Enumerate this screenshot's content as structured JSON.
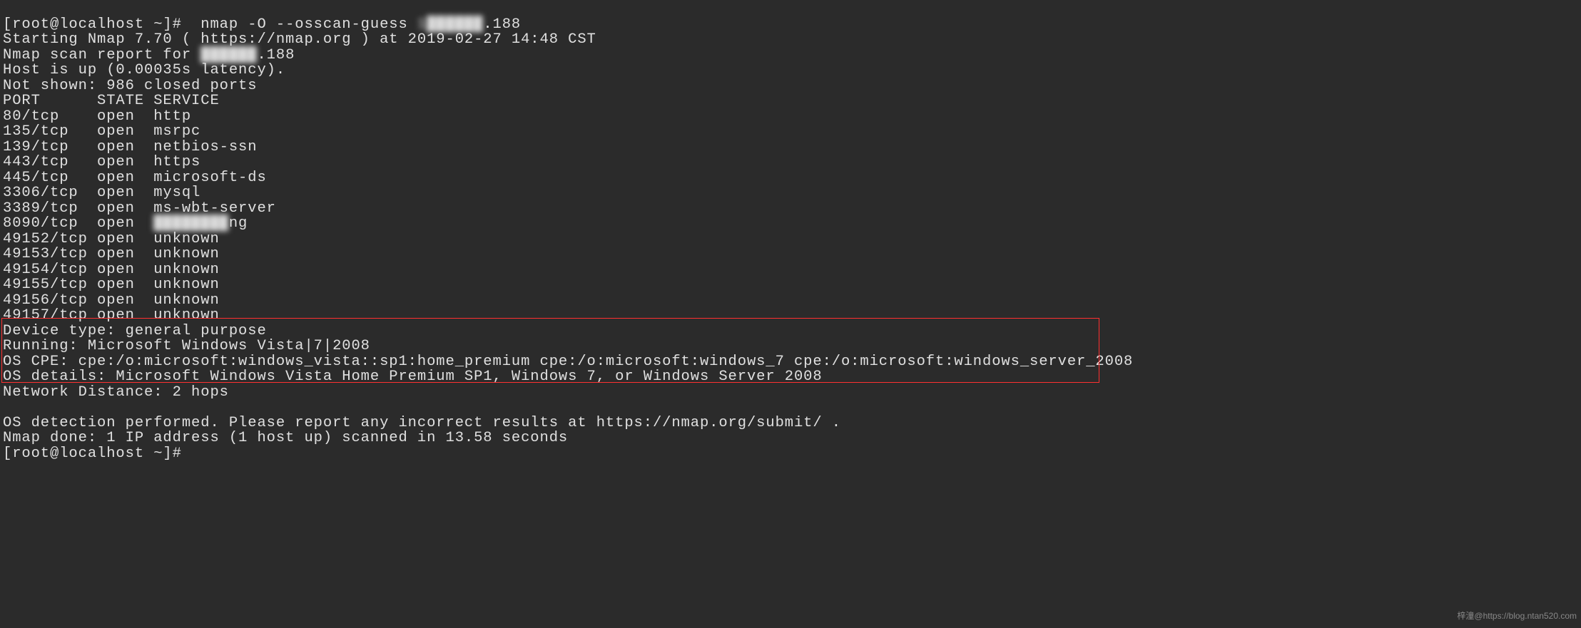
{
  "prompt": "[root@localhost ~]#",
  "command": "  nmap -O --osscan-guess ",
  "target_ip_blur": "1██████",
  "target_ip_suffix": ".188",
  "start_line": "Starting Nmap 7.70 ( https://nmap.org ) at 2019-02-27 14:48 CST",
  "scan_report_prefix": "Nmap scan report for ",
  "scan_report_ip_blur": "██████",
  "scan_report_ip_suffix": ".188",
  "host_up": "Host is up (0.00035s latency).",
  "not_shown": "Not shown: 986 closed ports",
  "header": "PORT      STATE SERVICE",
  "ports": [
    {
      "port": "80/tcp    open  http",
      "blur": false
    },
    {
      "port": "135/tcp   open  msrpc",
      "blur": false
    },
    {
      "port": "139/tcp   open  netbios-ssn",
      "blur": false
    },
    {
      "port": "443/tcp   open  https",
      "blur": false
    },
    {
      "port": "445/tcp   open  microsoft-ds",
      "blur": false
    },
    {
      "port": "3306/tcp  open  mysql",
      "blur": false
    },
    {
      "port": "3389/tcp  open  ms-wbt-server",
      "blur": false
    }
  ],
  "port_8090_prefix": "8090/tcp  open  ",
  "port_8090_blur": "████████",
  "port_8090_suffix": "ng",
  "ports_high": [
    "49152/tcp open  unknown",
    "49153/tcp open  unknown",
    "49154/tcp open  unknown",
    "49155/tcp open  unknown",
    "49156/tcp open  unknown",
    "49157/tcp open  unknown"
  ],
  "device_type": "Device type: general purpose",
  "running": "Running: Microsoft Windows Vista|7|2008",
  "os_cpe": "OS CPE: cpe:/o:microsoft:windows_vista::sp1:home_premium cpe:/o:microsoft:windows_7 cpe:/o:microsoft:windows_server_2008",
  "os_details": "OS details: Microsoft Windows Vista Home Premium SP1, Windows 7, or Windows Server 2008",
  "network_distance": "Network Distance: 2 hops",
  "blank": "",
  "os_detection": "OS detection performed. Please report any incorrect results at https://nmap.org/submit/ .",
  "nmap_done": "Nmap done: 1 IP address (1 host up) scanned in 13.58 seconds",
  "prompt2": "[root@localhost ~]#",
  "watermark": "梓潼@https://blog.ntan520.com"
}
